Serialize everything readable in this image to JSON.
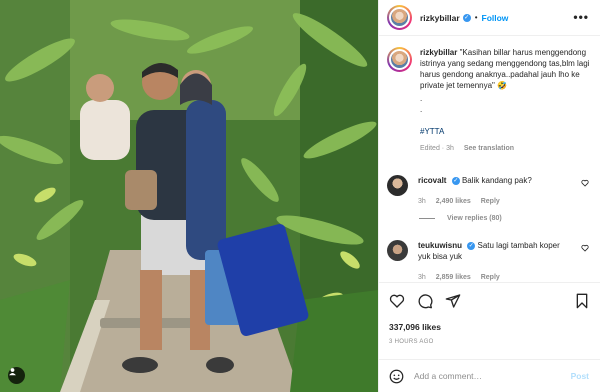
{
  "post": {
    "username": "rizkybillar",
    "follow_label": "Follow",
    "more_label": "•••",
    "caption_text": "\"Kasihan billar harus menggendong istrinya yang sedang menggendong tas,blm lagi harus gendong anaknya..padahal jauh lho ke private jet temennya\" 🤣",
    "caption_dots": ".\n.",
    "hashtag": "#YTTA",
    "caption_meta": "Edited · 3h",
    "see_translation": "See translation"
  },
  "comments": [
    {
      "username": "ricovalt",
      "text": "Balik kandang pak?",
      "time": "3h",
      "likes": "2,490 likes",
      "reply": "Reply"
    },
    {
      "username": "teukuwisnu",
      "text": "Satu lagi tambah koper yuk bisa yuk",
      "time": "3h",
      "likes": "2,859 likes",
      "reply": "Reply"
    }
  ],
  "view_replies": "View replies (80)",
  "likes_count": "337,096 likes",
  "time_ago": "3 HOURS AGO",
  "add_comment": {
    "placeholder": "Add a comment…",
    "post_label": "Post"
  },
  "icons": [
    "heart-icon",
    "comment-icon",
    "share-icon",
    "bookmark-icon",
    "emoji-icon",
    "user-tag-icon",
    "more-icon"
  ],
  "colors": {
    "link": "#0095f6",
    "verified": "#3897f0",
    "hashtag": "#00376b",
    "muted": "#8e8e8e",
    "post_disabled": "#b2dffc"
  }
}
